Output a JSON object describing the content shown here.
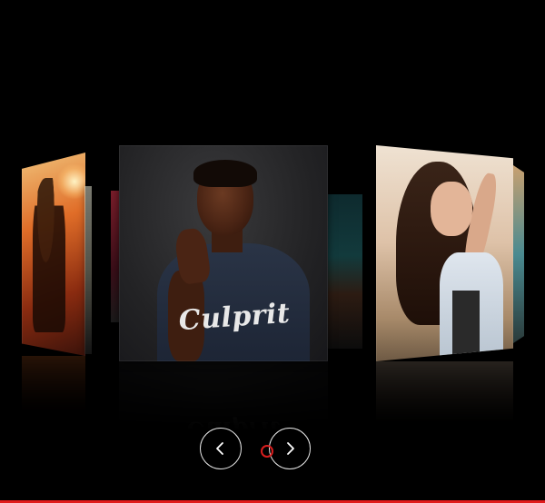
{
  "carousel": {
    "slides": [
      {
        "name": "sunset-silhouette-photo"
      },
      {
        "name": "man-in-culprit-tshirt-photo",
        "shirt_text": "Culprit"
      },
      {
        "name": "woman-long-hair-photo"
      }
    ],
    "prev_icon": "chevron-left-icon",
    "next_icon": "chevron-right-icon"
  },
  "colors": {
    "background": "#000000",
    "accent": "#e01b1b",
    "nav_border": "#e6e6e6"
  }
}
